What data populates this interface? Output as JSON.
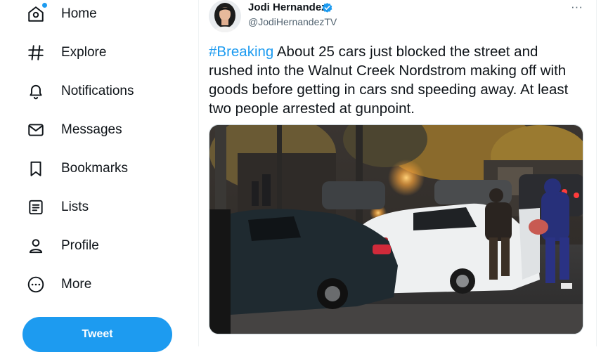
{
  "sidebar": {
    "items": [
      {
        "label": "Home",
        "icon": "home-icon"
      },
      {
        "label": "Explore",
        "icon": "hashtag-icon"
      },
      {
        "label": "Notifications",
        "icon": "bell-icon"
      },
      {
        "label": "Messages",
        "icon": "envelope-icon"
      },
      {
        "label": "Bookmarks",
        "icon": "bookmark-icon"
      },
      {
        "label": "Lists",
        "icon": "list-icon"
      },
      {
        "label": "Profile",
        "icon": "person-icon"
      },
      {
        "label": "More",
        "icon": "more-circle-icon"
      }
    ],
    "tweet_button": "Tweet"
  },
  "tweet": {
    "author_name": "Jodi Hernandez",
    "author_handle": "@JodiHernandezTV",
    "hashtag": "#Breaking",
    "text": " About 25 cars just blocked the street and rushed into the Walnut Creek Nordstrom making off with goods before getting in cars snd speeding away. At least two people arrested at gunpoint.",
    "more_icon": "···"
  },
  "colors": {
    "accent": "#1d9bf0",
    "text": "#0f1419",
    "secondary_text": "#536471"
  }
}
